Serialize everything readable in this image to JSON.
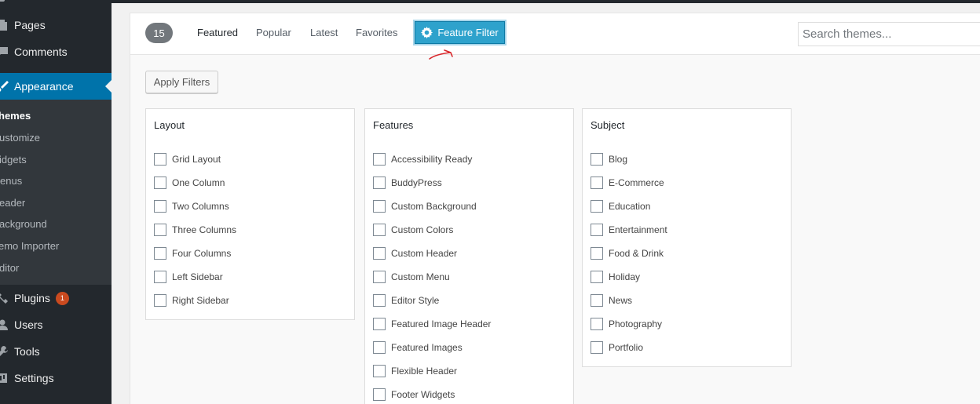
{
  "sidebar": {
    "items": [
      {
        "label": "Pages",
        "icon": "pages-icon"
      },
      {
        "label": "Comments",
        "icon": "comments-icon"
      },
      {
        "label": "Appearance",
        "icon": "appearance-brush-icon"
      },
      {
        "label": "Plugins",
        "icon": "plugins-icon",
        "badge": "1"
      },
      {
        "label": "Users",
        "icon": "users-icon"
      },
      {
        "label": "Tools",
        "icon": "tools-icon"
      },
      {
        "label": "Settings",
        "icon": "settings-icon"
      }
    ],
    "submenu": [
      "hemes",
      "ustomize",
      "idgets",
      "enus",
      "eader",
      "ackground",
      "emo Importer",
      "ditor"
    ],
    "colors": {
      "bg": "#23282d",
      "active": "#0073aa",
      "submenu_bg": "#32373c",
      "badge": "#ca4a1f"
    }
  },
  "filterbar": {
    "count": "15",
    "tabs": [
      "Featured",
      "Popular",
      "Latest",
      "Favorites"
    ],
    "feature_filter_label": "Feature Filter",
    "search_placeholder": "Search themes..."
  },
  "apply_filters_label": "Apply Filters",
  "groups": [
    {
      "title": "Layout",
      "options": [
        "Grid Layout",
        "One Column",
        "Two Columns",
        "Three Columns",
        "Four Columns",
        "Left Sidebar",
        "Right Sidebar"
      ]
    },
    {
      "title": "Features",
      "options": [
        "Accessibility Ready",
        "BuddyPress",
        "Custom Background",
        "Custom Colors",
        "Custom Header",
        "Custom Menu",
        "Editor Style",
        "Featured Image Header",
        "Featured Images",
        "Flexible Header",
        "Footer Widgets"
      ]
    },
    {
      "title": "Subject",
      "options": [
        "Blog",
        "E-Commerce",
        "Education",
        "Entertainment",
        "Food & Drink",
        "Holiday",
        "News",
        "Photography",
        "Portfolio"
      ]
    }
  ]
}
